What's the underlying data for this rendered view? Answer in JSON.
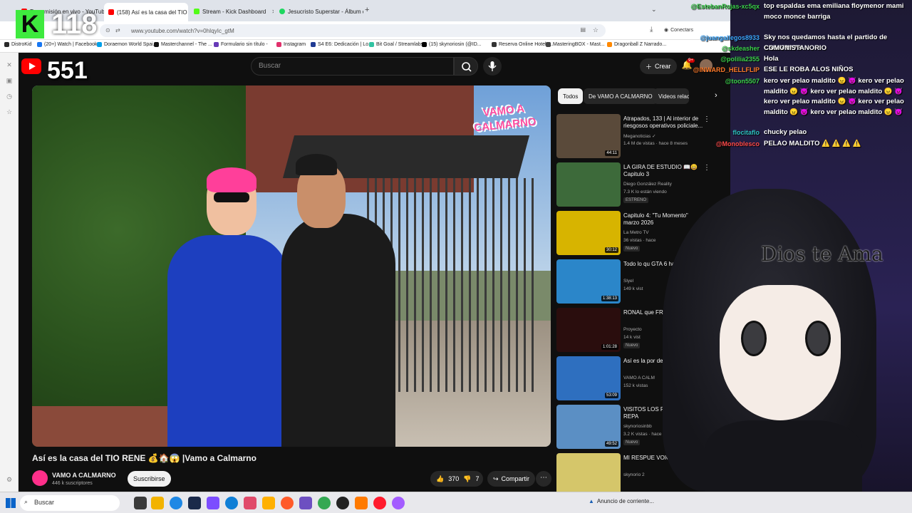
{
  "browser": {
    "tabs": [
      {
        "label": "Transmisión en vivo - YouTube",
        "color": "#ff0000"
      },
      {
        "label": "(158) Así es la casa del TIO RENE",
        "color": "#ff0000"
      },
      {
        "label": "Stream - Kick Dashboard",
        "color": "#53fc18"
      },
      {
        "label": "Jesucristo Superstar - Álbum de",
        "color": "#1ed760"
      }
    ],
    "url": "www.youtube.com/watch?v=0hIqyIc_gtM",
    "profile_label": "Conectars",
    "bookmarks": [
      {
        "label": "DistroKid",
        "color": "#2a2a2a"
      },
      {
        "label": "(20+) Watch | Facebook",
        "color": "#1877f2"
      },
      {
        "label": "Doraemon World Spai...",
        "color": "#00a0e9"
      },
      {
        "label": "Masterchannel - The ...",
        "color": "#111111"
      },
      {
        "label": "Formulario sin título -",
        "color": "#673ab7"
      },
      {
        "label": "Instagram",
        "color": "#e1306c"
      },
      {
        "label": "S4 E6: Dedicación | Lo...",
        "color": "#1f3a93"
      },
      {
        "label": "Bit Goal / Streamlabs",
        "color": "#31c3a2"
      },
      {
        "label": "(15) skynoriosin (@ID...",
        "color": "#000000"
      },
      {
        "label": "Reserva Online Hotele...",
        "color": "#333333"
      },
      {
        "label": "MasteringBOX - Mast...",
        "color": "#444444"
      },
      {
        "label": "Dragonball Z Narrado...",
        "color": "#ff8800"
      }
    ]
  },
  "youtube": {
    "search_placeholder": "Buscar",
    "create_label": "Crear",
    "notif_count": "9+",
    "video_title": "Así es la casa del TIO RENE 💰🏠😱 |Vamo a Calmarno",
    "video_logo_text": "VAMO A CALMARNO",
    "channel": {
      "name": "VAMO A CALMARNO",
      "subs": "446 k suscriptores"
    },
    "subscribe_label": "Suscribirse",
    "likes": "370",
    "dislikes": "7",
    "share_label": "Compartir",
    "chips": [
      "Todos",
      "De VAMO A CALMARNO",
      "Videos relac"
    ],
    "recommendations": [
      {
        "title": "Atrapados, 133 | Al interior de riesgosos operativos policiale...",
        "channel": "Meganoticias ✓",
        "meta": "1.4 M de vistas · hace 8 meses",
        "duration": "44:11",
        "badge": "",
        "color": "#5a4a3a"
      },
      {
        "title": "LA GIRA DE ESTUDIO 📖😀 Capitulo 3",
        "channel": "Diego González Reality",
        "meta": "7.3 K lo están viendo",
        "duration": "",
        "badge": "ESTRENO",
        "color": "#3d6a3a"
      },
      {
        "title": "Capitulo 4: \"Tu Momento\" marzo 2026",
        "channel": "La Metro TV",
        "meta": "36 vistas · hace",
        "duration": "30:12",
        "badge": "Nuevo",
        "color": "#d7b400"
      },
      {
        "title": "Todo lo qu GTA 6 ha",
        "channel": "Slyel",
        "meta": "149 k vist",
        "duration": "1:38:13",
        "badge": "",
        "color": "#2b86c9"
      },
      {
        "title": "RONAL que FR",
        "channel": "Proyecto",
        "meta": "14 k vist",
        "duration": "1:01:28",
        "badge": "Nuevo",
        "color": "#2a0d0d"
      },
      {
        "title": "Así es la por dentro",
        "channel": "VAMO A CALM",
        "meta": "152 k vistas",
        "duration": "53:09",
        "badge": "",
        "color": "#2e6fbf"
      },
      {
        "title": "VISITOS LOS RU PLAYA Y REPA",
        "channel": "skynoriosinbb",
        "meta": "3.2 K vistas · hace",
        "duration": "49:52",
        "badge": "Nuevo",
        "color": "#5b8fc4"
      },
      {
        "title": "MI RESPUE VOICE (ME C",
        "channel": "skynorio 2",
        "meta": "",
        "duration": "",
        "badge": "",
        "color": "#d5c66a"
      }
    ]
  },
  "overlay": {
    "kick_logo": "K",
    "kick_viewers": "118",
    "youtube_viewers": "551",
    "dios_text": "Dios te Ama"
  },
  "chat": [
    {
      "user": "@EstebanRojas-xc5qx",
      "msg": "top espaldas ema emiliana floymenor mami moco monce barriga",
      "ucolor": "#3bd14b"
    },
    {
      "user": "@juangallegos8933",
      "msg": "Sky nos quedamos hasta el partido de Chile?????",
      "ucolor": "#3ba7ff"
    },
    {
      "user": "@skdeasher",
      "msg": "COMUNISTANORIO",
      "ucolor": "#3bd14b"
    },
    {
      "user": "@polilia2355",
      "msg": "Hola",
      "ucolor": "#3bd14b"
    },
    {
      "user": "@INWARD_HELLFLIP",
      "msg": "ESE LE ROBA ALOS NIÑOS",
      "ucolor": "#ff7b2a"
    },
    {
      "user": "@toon5507",
      "msg": "kero ver pelao maldito 😠 👿 kero ver pelao maldito 😠 👿 kero ver pelao maldito 😠 👿 kero ver pelao maldito 😠 👿 kero ver pelao maldito 😠 👿 kero ver pelao maldito 😠 👿",
      "ucolor": "#3bd14b"
    },
    {
      "user": "flocitaflo",
      "msg": "chucky pelao",
      "ucolor": "#2ec4c4"
    },
    {
      "user": "@Monoblesco",
      "msg": "PELAO MALDITO ⚠️ ⚠️ ⚠️ ⚠️",
      "ucolor": "#ff4a4a"
    }
  ],
  "taskbar": {
    "search_label": "Buscar",
    "status_text": "Anuncio de corriente..."
  }
}
